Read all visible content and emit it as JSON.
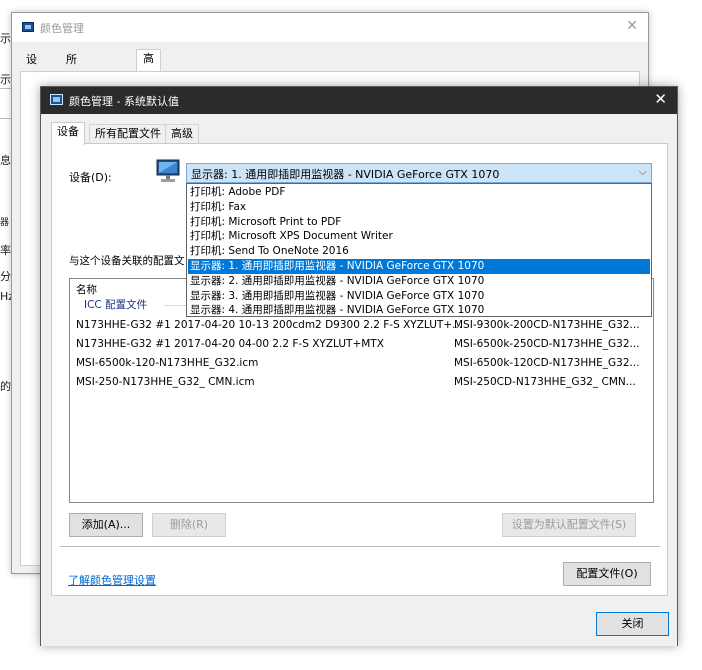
{
  "background_fragments": [
    "示器",
    "示",
    "息",
    "器",
    "率",
    "分辨",
    "Hz",
    "的显",
    "设"
  ],
  "back_window": {
    "title": "颜色管理",
    "tabs": [
      "设备",
      "所有配置文件",
      "高级"
    ],
    "active_tab": "高级"
  },
  "front_window": {
    "title": "颜色管理 - 系统默认值",
    "tabs": [
      {
        "label": "设备"
      },
      {
        "label": "所有配置文件"
      },
      {
        "label": "高级"
      }
    ],
    "device_label": "设备(D):",
    "device_select": {
      "value": "显示器: 1. 通用即插即用监视器 - NVIDIA GeForce GTX 1070"
    },
    "dropdown_options": [
      "打印机: Adobe PDF",
      "打印机: Fax",
      "打印机: Microsoft Print to PDF",
      "打印机: Microsoft XPS Document Writer",
      "打印机: Send To OneNote 2016",
      "显示器: 1. 通用即插即用监视器 - NVIDIA GeForce GTX 1070",
      "显示器: 2. 通用即插即用监视器 - NVIDIA GeForce GTX 1070",
      "显示器: 3. 通用即插即用监视器 - NVIDIA GeForce GTX 1070",
      "显示器: 4. 通用即插即用监视器 - NVIDIA GeForce GTX 1070"
    ],
    "selected_option_index": 5,
    "associated_label": "与这个设备关联的配置文",
    "profile_list": {
      "column_header": "名称",
      "group_label": "ICC 配置文件",
      "rows": [
        {
          "name": "N173HHE-G32 #1 2017-04-20 10-13 200cdm2 D9300 2.2 F-S XYZLUT+...",
          "file": "MSI-9300k-200CD-N173HHE_G32..."
        },
        {
          "name": "N173HHE-G32 #1 2017-04-20 04-00 2.2 F-S XYZLUT+MTX",
          "file": "MSI-6500k-250CD-N173HHE_G32..."
        },
        {
          "name": "MSI-6500k-120-N173HHE_G32.icm",
          "file": "MSI-6500k-120CD-N173HHE_G32..."
        },
        {
          "name": "MSI-250-N173HHE_G32_ CMN.icm",
          "file": "MSI-250CD-N173HHE_G32_ CMN..."
        }
      ]
    },
    "buttons": {
      "add": "添加(A)...",
      "remove": "删除(R)",
      "set_default": "设置为默认配置文件(S)",
      "profiles": "配置文件(O)",
      "close": "关闭"
    },
    "learn_link": "了解颜色管理设置"
  },
  "colors": {
    "selection": "#0078d7",
    "title_bar_dark": "#2b2b2b",
    "link": "#0066cc"
  }
}
